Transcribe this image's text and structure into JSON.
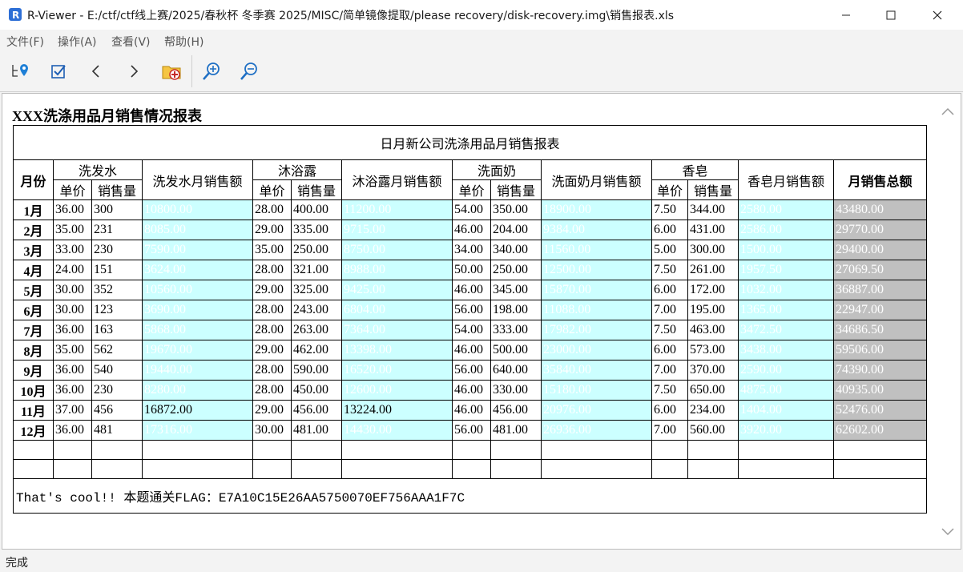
{
  "window": {
    "title": "R-Viewer - E:/ctf/ctf线上赛/2025/春秋杯 冬季赛 2025/MISC/简单镜像提取/please recovery/disk-recovery.img\\销售报表.xls"
  },
  "menu": [
    "文件(F)",
    "操作(A)",
    "查看(V)",
    "帮助(H)"
  ],
  "doc": {
    "heading": "XXX洗涤用品月销售情况报表",
    "big_title": "日月新公司洗涤用品月销售报表",
    "headers": {
      "month": "月份",
      "shampoo": "洗发水",
      "shampoo_total": "洗发水月销售额",
      "bodywash": "沐浴露",
      "bodywash_total": "沐浴露月销售额",
      "cleanser": "洗面奶",
      "cleanser_total": "洗面奶月销售额",
      "soap": "香皂",
      "soap_total": "香皂月销售额",
      "grand_total": "月销售总额",
      "unit_price": "单价",
      "qty": "销售量"
    },
    "rows": [
      [
        "1月",
        "36.00",
        "300",
        "10800.00",
        "28.00",
        "400.00",
        "11200.00",
        "54.00",
        "350.00",
        "18900.00",
        "7.50",
        "344.00",
        "2580.00",
        "43480.00"
      ],
      [
        "2月",
        "35.00",
        "231",
        "8085.00",
        "29.00",
        "335.00",
        "9715.00",
        "46.00",
        "204.00",
        "9384.00",
        "6.00",
        "431.00",
        "2586.00",
        "29770.00"
      ],
      [
        "3月",
        "33.00",
        "230",
        "7590.00",
        "35.00",
        "250.00",
        "8750.00",
        "34.00",
        "340.00",
        "11560.00",
        "5.00",
        "300.00",
        "1500.00",
        "29400.00"
      ],
      [
        "4月",
        "24.00",
        "151",
        "3624.00",
        "28.00",
        "321.00",
        "8988.00",
        "50.00",
        "250.00",
        "12500.00",
        "7.50",
        "261.00",
        "1957.50",
        "27069.50"
      ],
      [
        "5月",
        "30.00",
        "352",
        "10560.00",
        "29.00",
        "325.00",
        "9425.00",
        "46.00",
        "345.00",
        "15870.00",
        "6.00",
        "172.00",
        "1032.00",
        "36887.00"
      ],
      [
        "6月",
        "30.00",
        "123",
        "3690.00",
        "28.00",
        "243.00",
        "6804.00",
        "56.00",
        "198.00",
        "11088.00",
        "7.00",
        "195.00",
        "1365.00",
        "22947.00"
      ],
      [
        "7月",
        "36.00",
        "163",
        "5868.00",
        "28.00",
        "263.00",
        "7364.00",
        "54.00",
        "333.00",
        "17982.00",
        "7.50",
        "463.00",
        "3472.50",
        "34686.50"
      ],
      [
        "8月",
        "35.00",
        "562",
        "19670.00",
        "29.00",
        "462.00",
        "13398.00",
        "46.00",
        "500.00",
        "23000.00",
        "6.00",
        "573.00",
        "3438.00",
        "59506.00"
      ],
      [
        "9月",
        "36.00",
        "540",
        "19440.00",
        "28.00",
        "590.00",
        "16520.00",
        "56.00",
        "640.00",
        "35840.00",
        "7.00",
        "370.00",
        "2590.00",
        "74390.00"
      ],
      [
        "10月",
        "36.00",
        "230",
        "8280.00",
        "28.00",
        "450.00",
        "12600.00",
        "46.00",
        "330.00",
        "15180.00",
        "7.50",
        "650.00",
        "4875.00",
        "40935.00"
      ],
      [
        "11月",
        "37.00",
        "456",
        "16872.00",
        "29.00",
        "456.00",
        "13224.00",
        "46.00",
        "456.00",
        "20976.00",
        "6.00",
        "234.00",
        "1404.00",
        "52476.00"
      ],
      [
        "12月",
        "36.00",
        "481",
        "17316.00",
        "30.00",
        "481.00",
        "14430.00",
        "56.00",
        "481.00",
        "26936.00",
        "7.00",
        "560.00",
        "3920.00",
        "62602.00"
      ]
    ],
    "flag_text": "That's cool!! 本题通关FLAG：E7A10C15E26AA5750070EF756AAA1F7C"
  },
  "status": {
    "text": "完成"
  },
  "icons": {
    "app": "r-viewer-icon",
    "toolbar": [
      "tree-location-icon",
      "checkbox-icon",
      "back-chevron-icon",
      "forward-chevron-icon",
      "recover-folder-icon",
      "zoom-in-icon",
      "zoom-out-icon"
    ]
  },
  "colors": {
    "cyan_fill": "#ccffff",
    "gray_fill": "#c0c0c0"
  }
}
